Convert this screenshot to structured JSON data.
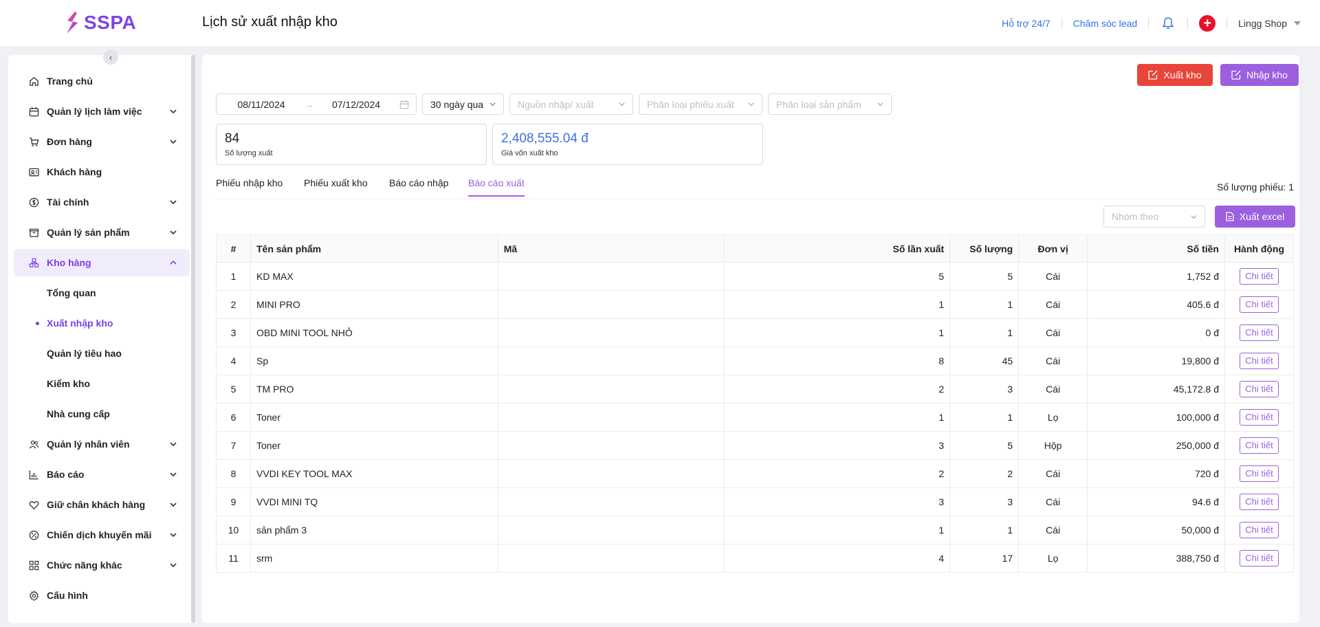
{
  "header": {
    "brand": "SSPA",
    "page_title": "Lịch sử xuất nhập kho",
    "support_link": "Hỗ trợ 24/7",
    "lead_link": "Chăm sóc lead",
    "shop_name": "Lingg Shop"
  },
  "sidebar": {
    "items": [
      {
        "label": "Trang chủ",
        "icon": "home-icon",
        "has_children": false
      },
      {
        "label": "Quản lý lịch làm việc",
        "icon": "calendar-icon",
        "has_children": true
      },
      {
        "label": "Đơn hàng",
        "icon": "cart-icon",
        "has_children": true
      },
      {
        "label": "Khách hàng",
        "icon": "id-card-icon",
        "has_children": false
      },
      {
        "label": "Tài chính",
        "icon": "dollar-icon",
        "has_children": true
      },
      {
        "label": "Quản lý sản phẩm",
        "icon": "box-icon",
        "has_children": true
      },
      {
        "label": "Kho hàng",
        "icon": "warehouse-icon",
        "has_children": true,
        "expanded": true,
        "active": true
      },
      {
        "label": "Quản lý nhân viên",
        "icon": "users-icon",
        "has_children": true
      },
      {
        "label": "Báo cáo",
        "icon": "chart-icon",
        "has_children": true
      },
      {
        "label": "Giữ chân khách hàng",
        "icon": "heart-icon",
        "has_children": true
      },
      {
        "label": "Chiến dịch khuyến mãi",
        "icon": "percent-icon",
        "has_children": true
      },
      {
        "label": "Chức năng khác",
        "icon": "grid-icon",
        "has_children": true
      },
      {
        "label": "Cấu hình",
        "icon": "gear-icon",
        "has_children": false
      }
    ],
    "warehouse_sub": [
      {
        "label": "Tổng quan",
        "active": false
      },
      {
        "label": "Xuất nhập kho",
        "active": true
      },
      {
        "label": "Quản lý tiêu hao",
        "active": false
      },
      {
        "label": "Kiểm kho",
        "active": false
      },
      {
        "label": "Nhà cung cấp",
        "active": false
      }
    ]
  },
  "actions": {
    "export_label": "Xuất kho",
    "import_label": "Nhập kho",
    "excel_label": "Xuất excel"
  },
  "filters": {
    "date_from": "08/11/2024",
    "date_to": "07/12/2024",
    "period": "30 ngày qua",
    "source_placeholder": "Nguồn nhập/ xuất",
    "slip_type_placeholder": "Phân loại phiếu xuất",
    "product_type_placeholder": "Phân loại sản phẩm",
    "group_by_placeholder": "Nhóm theo"
  },
  "stats": {
    "export_qty": "84",
    "export_qty_label": "Số lượng xuất",
    "export_cost": "2,408,555.04 đ",
    "export_cost_label": "Giá vốn xuất kho"
  },
  "tabs": [
    "Phiếu nhập kho",
    "Phiếu xuất kho",
    "Báo cáo nhập",
    "Báo cáo xuất"
  ],
  "active_tab": "Báo cáo xuất",
  "slip_count": "Số lượng phiếu: 1",
  "table": {
    "columns": [
      "#",
      "Tên sản phẩm",
      "Mã",
      "Số lần xuất",
      "Số lượng",
      "Đơn vị",
      "Số tiền",
      "Hành động"
    ],
    "action_label": "Chi tiết",
    "rows": [
      [
        "1",
        "KD MAX",
        "",
        "5",
        "5",
        "Cái",
        "1,752 đ"
      ],
      [
        "2",
        "MINI PRO",
        "",
        "1",
        "1",
        "Cái",
        "405.6 đ"
      ],
      [
        "3",
        "OBD MINI TOOL NHỎ",
        "",
        "1",
        "1",
        "Cái",
        "0 đ"
      ],
      [
        "4",
        "Sp",
        "",
        "8",
        "45",
        "Cái",
        "19,800 đ"
      ],
      [
        "5",
        "TM PRO",
        "",
        "2",
        "3",
        "Cái",
        "45,172.8 đ"
      ],
      [
        "6",
        "Toner",
        "",
        "1",
        "1",
        "Lọ",
        "100,000 đ"
      ],
      [
        "7",
        "Toner",
        "",
        "3",
        "5",
        "Hộp",
        "250,000 đ"
      ],
      [
        "8",
        "VVDI KEY TOOL MAX",
        "",
        "2",
        "2",
        "Cái",
        "720 đ"
      ],
      [
        "9",
        "VVDI MINI TQ",
        "",
        "3",
        "3",
        "Cái",
        "94.6 đ"
      ],
      [
        "10",
        "sản phẩm 3",
        "",
        "1",
        "1",
        "Cái",
        "50,000 đ"
      ],
      [
        "11",
        "srm",
        "",
        "4",
        "17",
        "Lọ",
        "388,750 đ"
      ]
    ]
  },
  "colors": {
    "brand": "#7b45e8",
    "accent_purple": "#9b5fdf",
    "export_red": "#e8443a",
    "link_blue": "#2f73e8",
    "stat_blue": "#3f6fe0",
    "notify_red": "#e8102a"
  }
}
